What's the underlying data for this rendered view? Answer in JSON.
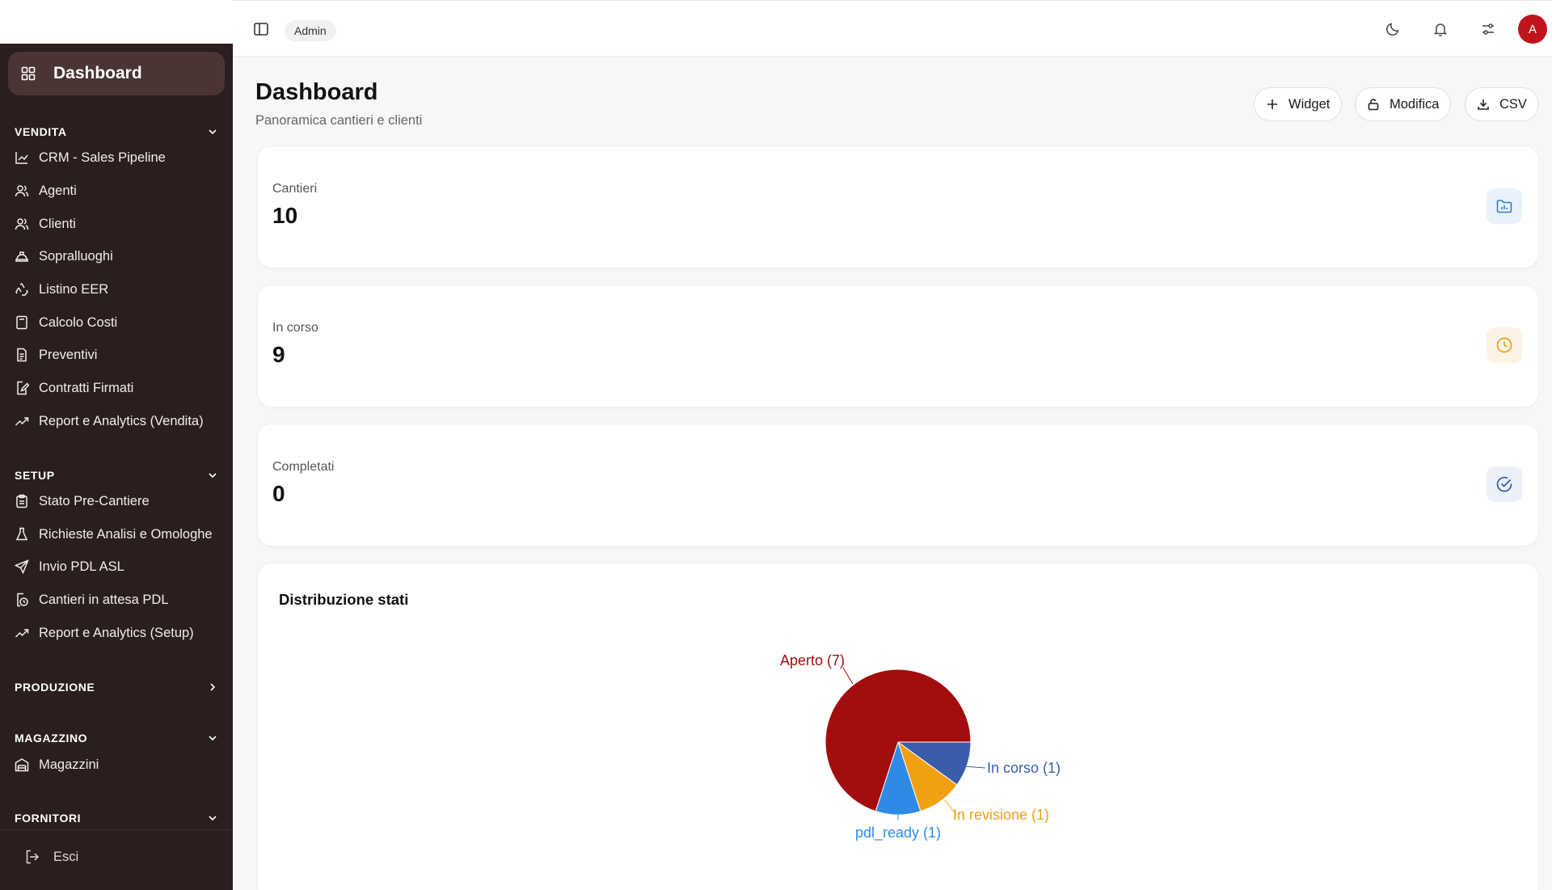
{
  "sidebar": {
    "dashboard_label": "Dashboard",
    "sections": {
      "vendita": "VENDITA",
      "setup": "SETUP",
      "produzione": "PRODUZIONE",
      "magazzino": "MAGAZZINO",
      "fornitori": "FORNITORI"
    },
    "vendita_items": [
      "CRM - Sales Pipeline",
      "Agenti",
      "Clienti",
      "Sopralluoghi",
      "Listino EER",
      "Calcolo Costi",
      "Preventivi",
      "Contratti Firmati",
      "Report e Analytics (Vendita)"
    ],
    "setup_items": [
      "Stato Pre-Cantiere",
      "Richieste Analisi e Omologhe",
      "Invio PDL ASL",
      "Cantieri in attesa PDL",
      "Report e Analytics (Setup)"
    ],
    "magazzino_items": [
      "Magazzini"
    ],
    "logout_label": "Esci"
  },
  "topbar": {
    "role_badge": "Admin",
    "avatar_initial": "A"
  },
  "page": {
    "title": "Dashboard",
    "subtitle": "Panoramica cantieri e clienti",
    "actions": {
      "widget": "Widget",
      "modifica": "Modifica",
      "csv": "CSV"
    }
  },
  "stats": [
    {
      "label": "Cantieri",
      "value": "10",
      "icon": "folder-chart-icon",
      "color": "#2f7fd0",
      "bg": "#e9f2fb"
    },
    {
      "label": "In corso",
      "value": "9",
      "icon": "clock-icon",
      "color": "#f0a020",
      "bg": "#fdf3e4"
    },
    {
      "label": "Completati",
      "value": "0",
      "icon": "check-circle-icon",
      "color": "#3a56a8",
      "bg": "#ecf0f8"
    }
  ],
  "colors": {
    "sidebar_bg": "#2a1e1e",
    "sidebar_active": "#4a3434",
    "accent_red": "#c0141c"
  },
  "chart_data": {
    "type": "pie",
    "title": "Distribuzione stati",
    "slices": [
      {
        "name": "Aperto",
        "value": 7,
        "label": "Aperto (7)",
        "color": "#a40d0d"
      },
      {
        "name": "In corso",
        "value": 1,
        "label": "In corso (1)",
        "color": "#3b5ca8"
      },
      {
        "name": "In revisione",
        "value": 1,
        "label": "In revisione (1)",
        "color": "#f0a012"
      },
      {
        "name": "pdl_ready",
        "value": 1,
        "label": "pdl_ready (1)",
        "color": "#2f8ae6"
      }
    ]
  }
}
